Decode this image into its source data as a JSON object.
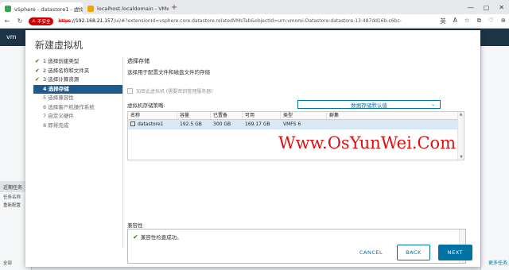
{
  "browser": {
    "tabs": [
      {
        "label": "vSphere - datastore1 - 虚拟机",
        "active": true
      },
      {
        "label": "localhost.localdomain - VMware",
        "active": false
      }
    ],
    "new_tab": "+",
    "window_controls": [
      "—",
      "▢",
      "✕"
    ],
    "insecure_label": "不安全",
    "url_scheme": "https",
    "url_host": "://192.168.21.157",
    "url_path": "/ui/#?extensionId=vsphere.core.datastore.relatedVMsTab&objectId=urn:vmomi:Datastore:datastore-13:487dd16b-c6bc-",
    "addr_icons": [
      "英",
      "A",
      "☆",
      "⧉",
      "♡",
      "⊕"
    ]
  },
  "app": {
    "header_brand": "vm",
    "recent_tasks_label": "近期任务",
    "recent_tasks_sub": [
      "任务名称",
      "重新配置"
    ],
    "all_label": "全部",
    "more_label": "更多任务"
  },
  "wizard": {
    "title": "新建虚拟机",
    "steps": [
      {
        "label": "1 选择创建类型",
        "state": "done"
      },
      {
        "label": "2 选择名称和文件夹",
        "state": "done"
      },
      {
        "label": "3 选择计算资源",
        "state": "done"
      },
      {
        "label": "4 选择存储",
        "state": "active"
      },
      {
        "label": "5 选择兼容性",
        "state": "pending"
      },
      {
        "label": "6 选择客户机操作系统",
        "state": "pending"
      },
      {
        "label": "7 自定义硬件",
        "state": "pending"
      },
      {
        "label": "8 即将完成",
        "state": "pending"
      }
    ],
    "section_title": "选择存储",
    "section_subtitle": "选择用于配置文件和磁盘文件的存储",
    "encrypt_label": "加密此虚拟机 (需要密钥管理服务器)",
    "policy_label": "虚拟机存储策略:",
    "policy_value": "数据存储默认值",
    "table": {
      "headers": [
        "名称",
        "容量",
        "已置备",
        "可用",
        "类型",
        "群集"
      ],
      "rows": [
        [
          "datastore1",
          "192.5 GB",
          "300 GB",
          "169.17 GB",
          "VMFS 6",
          ""
        ]
      ]
    },
    "compat_title": "兼容性",
    "compat_message": "兼容性检查成功。",
    "buttons": {
      "cancel": "CANCEL",
      "back": "BACK",
      "next": "NEXT"
    }
  },
  "watermark": "Www.OsYunWei.Com",
  "colors": {
    "accent": "#0072a3",
    "active_step": "#1e5a8c",
    "success": "#2f8400",
    "watermark": "#e01010"
  }
}
